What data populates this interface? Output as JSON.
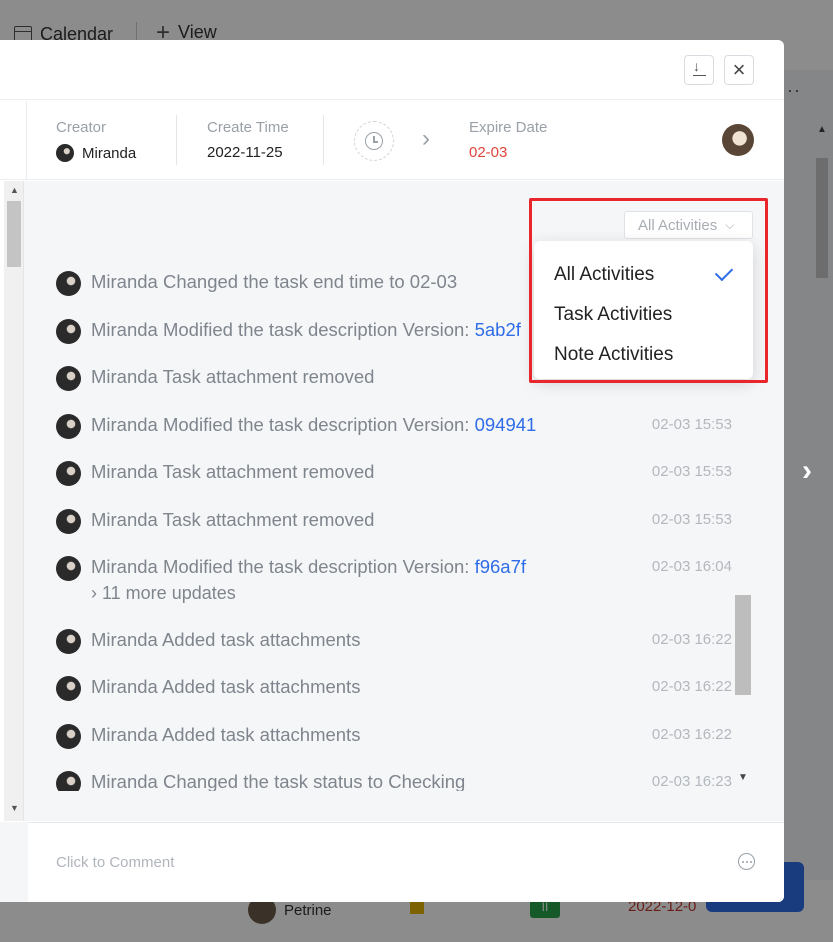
{
  "background": {
    "calendar_label": "Calendar",
    "view_label": "View",
    "more": "···",
    "row_assignee": "Petrine",
    "row_status": "II",
    "row_date": "2022-12-0"
  },
  "modal": {
    "info": {
      "creator_label": "Creator",
      "creator_name": "Miranda",
      "create_time_label": "Create Time",
      "create_time_value": "2022-11-25",
      "expire_label": "Expire Date",
      "expire_value": "02-03"
    },
    "filter": {
      "selected": "All Activities",
      "options": [
        "All Activities",
        "Task Activities",
        "Note Activities"
      ]
    },
    "activities": [
      {
        "user": "Miranda",
        "action": "Changed the task end time to 02-03",
        "version": "",
        "time": ""
      },
      {
        "user": "Miranda",
        "action": "Modified the task description Version: ",
        "version": "5ab2f",
        "time": ""
      },
      {
        "user": "Miranda",
        "action": "Task attachment removed",
        "version": "",
        "time": ""
      },
      {
        "user": "Miranda",
        "action": "Modified the task description Version: ",
        "version": "094941",
        "time": "02-03 15:53"
      },
      {
        "user": "Miranda",
        "action": "Task attachment removed",
        "version": "",
        "time": "02-03 15:53"
      },
      {
        "user": "Miranda",
        "action": "Task attachment removed",
        "version": "",
        "time": "02-03 15:53"
      },
      {
        "user": "Miranda",
        "action": "Modified the task description Version: ",
        "version": "f96a7f",
        "time": "02-03 16:04",
        "more": "› 11 more updates"
      },
      {
        "user": "Miranda",
        "action": "Added task attachments",
        "version": "",
        "time": "02-03 16:22"
      },
      {
        "user": "Miranda",
        "action": "Added task attachments",
        "version": "",
        "time": "02-03 16:22"
      },
      {
        "user": "Miranda",
        "action": "Added task attachments",
        "version": "",
        "time": "02-03 16:22"
      },
      {
        "user": "Miranda",
        "action": "Changed the task status to Checking",
        "version": "",
        "time": "02-03 16:23"
      }
    ],
    "comment_placeholder": "Click to Comment"
  },
  "colors": {
    "accent": "#2f6de8",
    "expire": "#e0453a",
    "highlight": "#e8262b"
  }
}
